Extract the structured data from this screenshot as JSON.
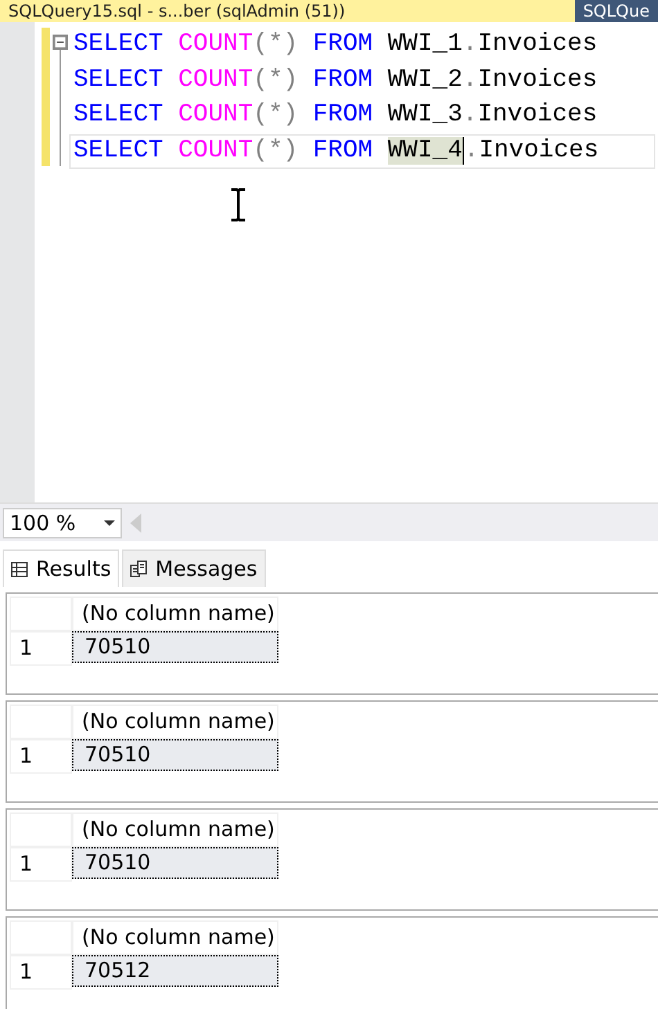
{
  "document_tabs": [
    {
      "title": "SQLQuery15.sql - s...ber (sqlAdmin (51))",
      "selected": true
    },
    {
      "title": "SQLQue",
      "selected": false
    }
  ],
  "editor": {
    "lines": [
      {
        "current": false,
        "tokens": [
          {
            "text": "SELECT ",
            "kind": "keyword"
          },
          {
            "text": "COUNT",
            "kind": "function"
          },
          {
            "text": "(*) ",
            "kind": "operator"
          },
          {
            "text": "FROM ",
            "kind": "keyword"
          },
          {
            "text": "WWI_1",
            "kind": "plain"
          },
          {
            "text": ".",
            "kind": "operator"
          },
          {
            "text": "Invoices",
            "kind": "plain"
          }
        ]
      },
      {
        "current": false,
        "tokens": [
          {
            "text": "SELECT ",
            "kind": "keyword"
          },
          {
            "text": "COUNT",
            "kind": "function"
          },
          {
            "text": "(*) ",
            "kind": "operator"
          },
          {
            "text": "FROM ",
            "kind": "keyword"
          },
          {
            "text": "WWI_2",
            "kind": "plain"
          },
          {
            "text": ".",
            "kind": "operator"
          },
          {
            "text": "Invoices",
            "kind": "plain"
          }
        ]
      },
      {
        "current": false,
        "tokens": [
          {
            "text": "SELECT ",
            "kind": "keyword"
          },
          {
            "text": "COUNT",
            "kind": "function"
          },
          {
            "text": "(*) ",
            "kind": "operator"
          },
          {
            "text": "FROM ",
            "kind": "keyword"
          },
          {
            "text": "WWI_3",
            "kind": "plain"
          },
          {
            "text": ".",
            "kind": "operator"
          },
          {
            "text": "Invoices",
            "kind": "plain"
          }
        ]
      },
      {
        "current": true,
        "tokens": [
          {
            "text": "SELECT ",
            "kind": "keyword"
          },
          {
            "text": "COUNT",
            "kind": "function"
          },
          {
            "text": "(*) ",
            "kind": "operator"
          },
          {
            "text": "FROM ",
            "kind": "keyword"
          },
          {
            "text": "WWI_4",
            "kind": "highlight"
          },
          {
            "text": ".",
            "kind": "operator"
          },
          {
            "text": "Invoices",
            "kind": "plain"
          }
        ]
      }
    ]
  },
  "zoom": {
    "value": "100 %"
  },
  "result_tabs": [
    {
      "label": "Results",
      "selected": true
    },
    {
      "label": "Messages",
      "selected": false
    }
  ],
  "result_sets": [
    {
      "column": "(No column name)",
      "rows": [
        {
          "number": "1",
          "value": "70510"
        }
      ]
    },
    {
      "column": "(No column name)",
      "rows": [
        {
          "number": "1",
          "value": "70510"
        }
      ]
    },
    {
      "column": "(No column name)",
      "rows": [
        {
          "number": "1",
          "value": "70510"
        }
      ]
    },
    {
      "column": "(No column name)",
      "rows": [
        {
          "number": "1",
          "value": "70512"
        }
      ]
    }
  ]
}
